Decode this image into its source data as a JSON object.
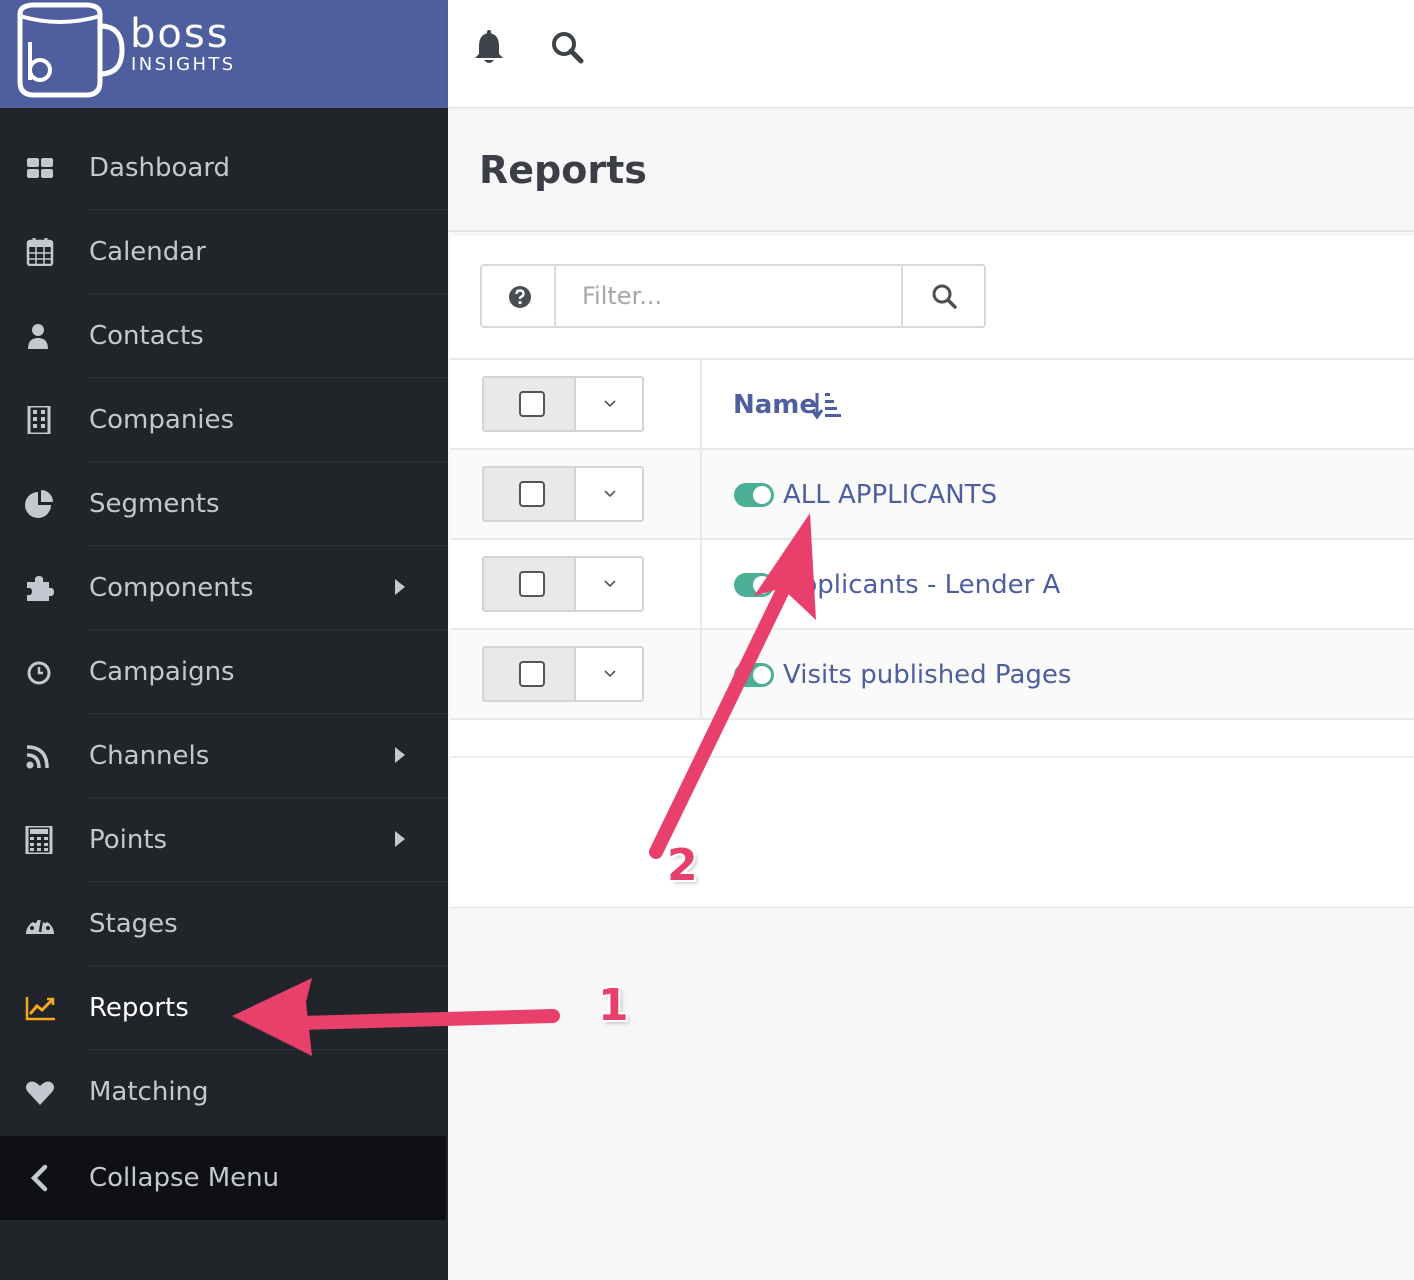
{
  "brand": {
    "word": "boss",
    "sub": "INSIGHTS",
    "color": "#4e5e9e"
  },
  "sidebar": {
    "items": [
      {
        "label": "Dashboard",
        "icon": "dashboard-icon"
      },
      {
        "label": "Calendar",
        "icon": "calendar-icon"
      },
      {
        "label": "Contacts",
        "icon": "user-icon"
      },
      {
        "label": "Companies",
        "icon": "building-icon"
      },
      {
        "label": "Segments",
        "icon": "pie-chart-icon"
      },
      {
        "label": "Components",
        "icon": "puzzle-icon",
        "has_submenu": true
      },
      {
        "label": "Campaigns",
        "icon": "clock-icon"
      },
      {
        "label": "Channels",
        "icon": "rss-icon",
        "has_submenu": true
      },
      {
        "label": "Points",
        "icon": "calculator-icon",
        "has_submenu": true
      },
      {
        "label": "Stages",
        "icon": "gauge-icon"
      },
      {
        "label": "Reports",
        "icon": "line-chart-icon",
        "active": true
      },
      {
        "label": "Matching",
        "icon": "heart-icon"
      }
    ],
    "collapse_label": "Collapse Menu",
    "active_color": "#f5a623"
  },
  "topbar": {
    "icons": [
      "bell-icon",
      "search-icon"
    ]
  },
  "page": {
    "title": "Reports"
  },
  "filter": {
    "placeholder": "Filter...",
    "help_icon": "question-circle-icon",
    "search_icon": "search-icon"
  },
  "table": {
    "column_name": "Name",
    "rows": [
      {
        "name": "ALL APPLICANTS",
        "enabled": true
      },
      {
        "name": "Applicants - Lender A",
        "enabled": true
      },
      {
        "name": "Visits published Pages",
        "enabled": true
      }
    ],
    "toggle_color": "#4cae95"
  },
  "annotations": {
    "step1": "1",
    "step2": "2",
    "arrow_color": "#e8406a"
  }
}
